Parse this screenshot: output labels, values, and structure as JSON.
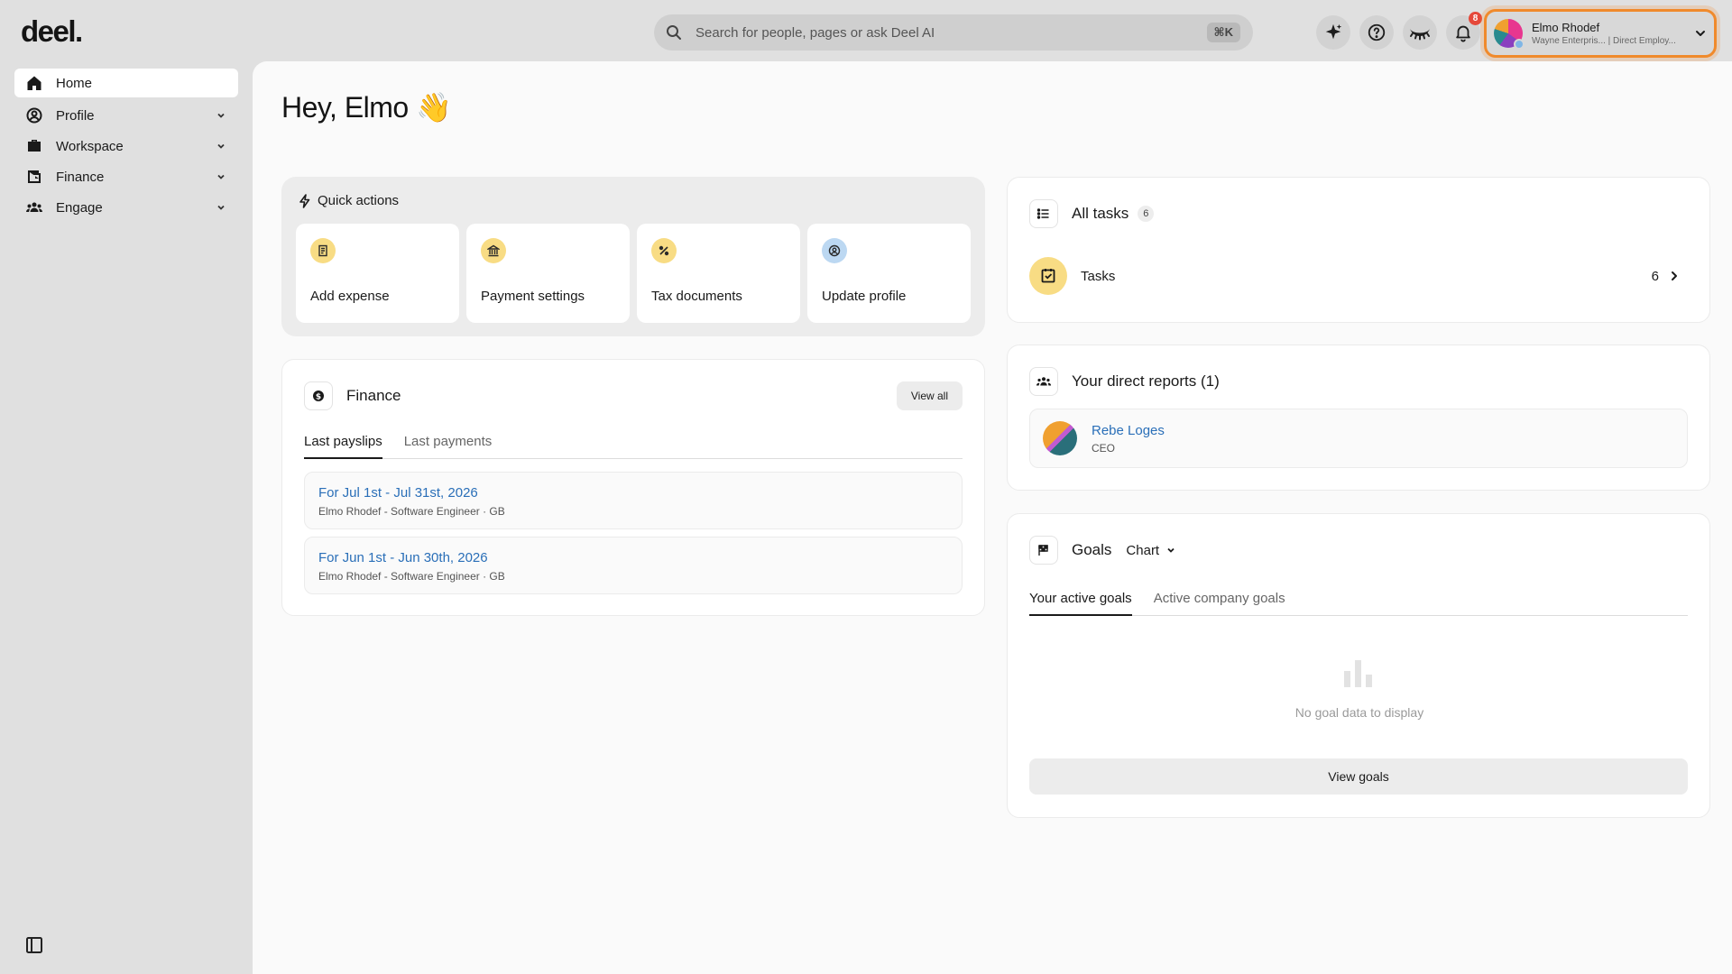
{
  "app": {
    "logo": "deel."
  },
  "search": {
    "placeholder": "Search for people, pages or ask Deel AI",
    "shortcut": "⌘K"
  },
  "topbar": {
    "notifications_count": "8",
    "user": {
      "name": "Elmo Rhodef",
      "subtitle": "Wayne Enterpris... | Direct Employ..."
    }
  },
  "sidebar": {
    "items": [
      {
        "label": "Home",
        "icon": "home-icon",
        "active": true
      },
      {
        "label": "Profile",
        "icon": "user-circle-icon",
        "expandable": true
      },
      {
        "label": "Workspace",
        "icon": "briefcase-icon",
        "expandable": true
      },
      {
        "label": "Finance",
        "icon": "wallet-icon",
        "expandable": true
      },
      {
        "label": "Engage",
        "icon": "people-icon",
        "expandable": true
      }
    ]
  },
  "greeting": "Hey, Elmo 👋",
  "quick_actions": {
    "title": "Quick actions",
    "items": [
      {
        "label": "Add expense",
        "icon": "receipt-icon"
      },
      {
        "label": "Payment settings",
        "icon": "bank-icon"
      },
      {
        "label": "Tax documents",
        "icon": "percent-icon"
      },
      {
        "label": "Update profile",
        "icon": "profile-icon"
      }
    ]
  },
  "finance": {
    "title": "Finance",
    "view_all": "View all",
    "tabs": [
      "Last payslips",
      "Last payments"
    ],
    "payslips": [
      {
        "title": "For Jul 1st - Jul 31st, 2026",
        "subtitle": "Elmo Rhodef - Software Engineer · GB"
      },
      {
        "title": "For Jun 1st - Jun 30th, 2026",
        "subtitle": "Elmo Rhodef - Software Engineer · GB"
      }
    ]
  },
  "tasks": {
    "title": "All tasks",
    "count": "6",
    "row_label": "Tasks",
    "row_count": "6"
  },
  "direct_reports": {
    "title": "Your direct reports (1)",
    "people": [
      {
        "name": "Rebe Loges",
        "role": "CEO"
      }
    ]
  },
  "goals": {
    "title": "Goals",
    "view_mode": "Chart",
    "tabs": [
      "Your active goals",
      "Active company goals"
    ],
    "empty_text": "No goal data to display",
    "view_goals": "View goals"
  },
  "colors": {
    "accent_orange": "#f08a2c",
    "link_blue": "#2a6fb8",
    "badge_red": "#e5483a",
    "icon_yellow": "#f8dc84"
  }
}
